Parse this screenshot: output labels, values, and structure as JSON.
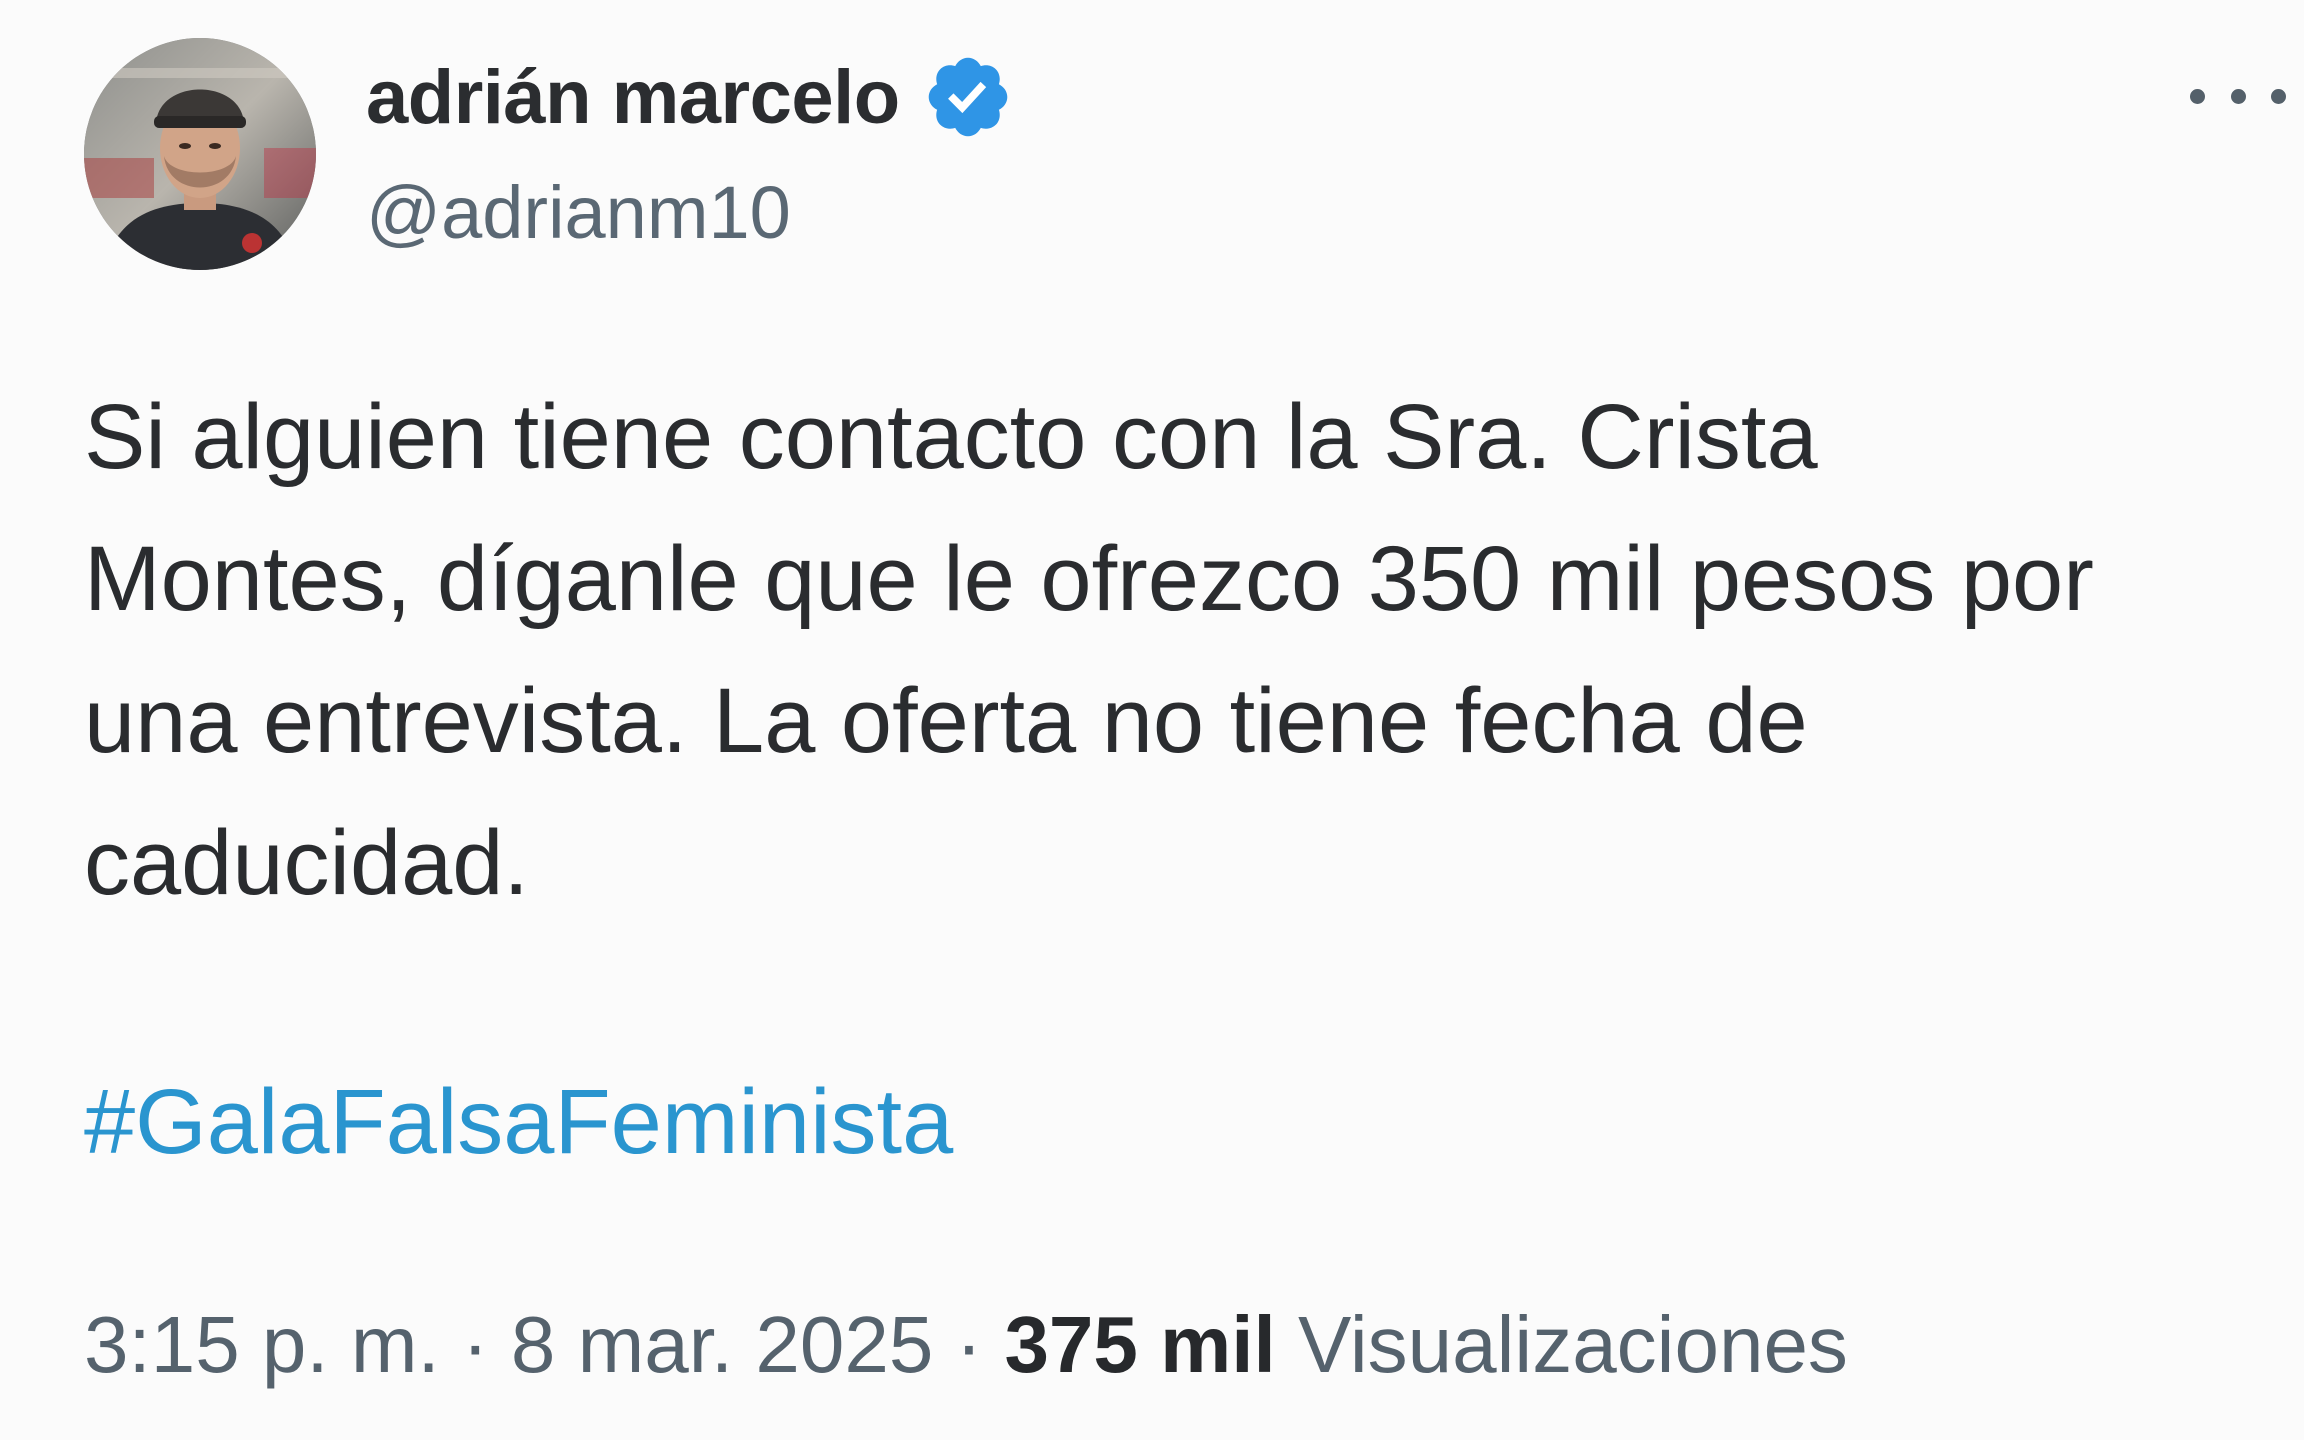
{
  "author": {
    "display_name": "adrián marcelo",
    "handle": "@adrianm10",
    "verified_icon": "verified-badge-icon",
    "avatar_icon": "profile-photo"
  },
  "more_icon": "more-horizontal-icon",
  "tweet": {
    "text_lines": [
      "Si alguien tiene contacto con la Sra. Crista",
      "Montes, díganle que le ofrezco 350 mil pesos por",
      "una entrevista. La oferta no tiene fecha de",
      "caducidad."
    ],
    "hashtag": "#GalaFalsaFeminista"
  },
  "meta": {
    "time": "3:15 p. m.",
    "separator": " · ",
    "date": "8 mar. 2025",
    "views_count": "375 mil",
    "views_label": "Visualizaciones"
  },
  "colors": {
    "link": "#2a95cf",
    "verified": "#2f95e6",
    "secondary_text": "#55626d",
    "background": "#fbfbfb"
  }
}
